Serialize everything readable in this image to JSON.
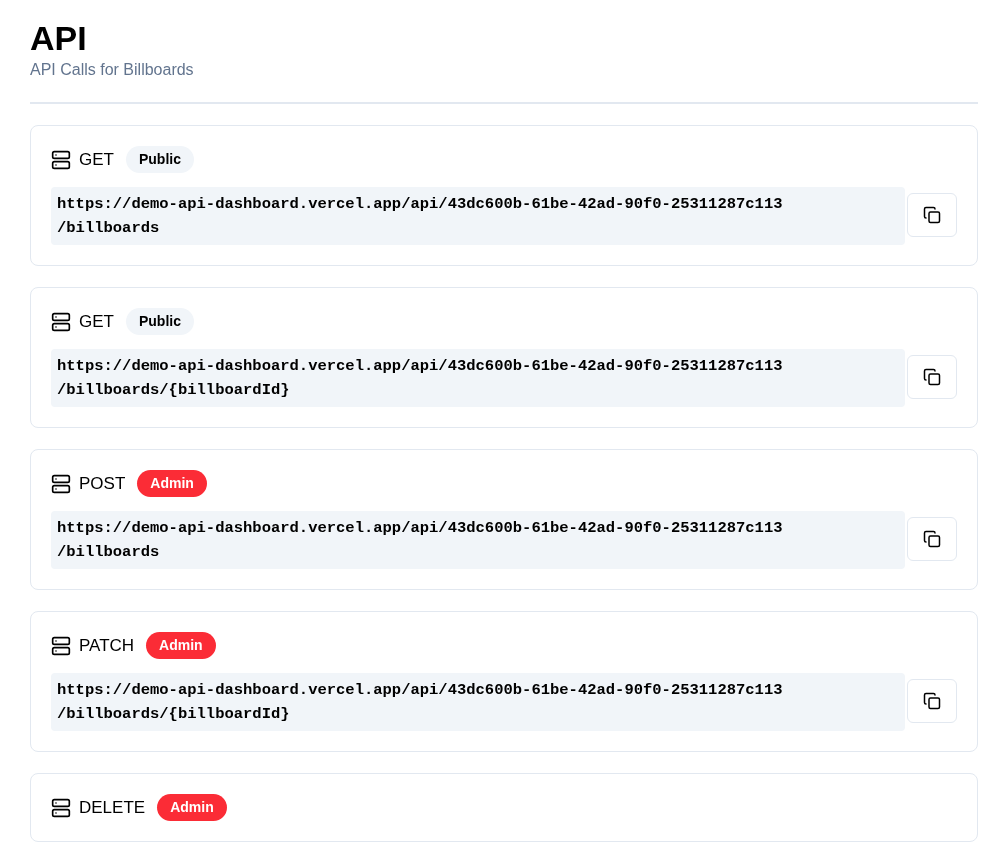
{
  "header": {
    "title": "API",
    "subtitle": "API Calls for Billboards"
  },
  "endpoints": [
    {
      "method": "GET",
      "kind": "public",
      "badge": "Public",
      "url": "https://demo-api-dashboard.vercel.app/api/43dc600b-61be-42ad-90f0-25311287c113",
      "path": "/billboards"
    },
    {
      "method": "GET",
      "kind": "public",
      "badge": "Public",
      "url": "https://demo-api-dashboard.vercel.app/api/43dc600b-61be-42ad-90f0-25311287c113",
      "path": "/billboards/{billboardId}"
    },
    {
      "method": "POST",
      "kind": "admin",
      "badge": "Admin",
      "url": "https://demo-api-dashboard.vercel.app/api/43dc600b-61be-42ad-90f0-25311287c113",
      "path": "/billboards"
    },
    {
      "method": "PATCH",
      "kind": "admin",
      "badge": "Admin",
      "url": "https://demo-api-dashboard.vercel.app/api/43dc600b-61be-42ad-90f0-25311287c113",
      "path": "/billboards/{billboardId}"
    },
    {
      "method": "DELETE",
      "kind": "admin",
      "badge": "Admin"
    }
  ]
}
